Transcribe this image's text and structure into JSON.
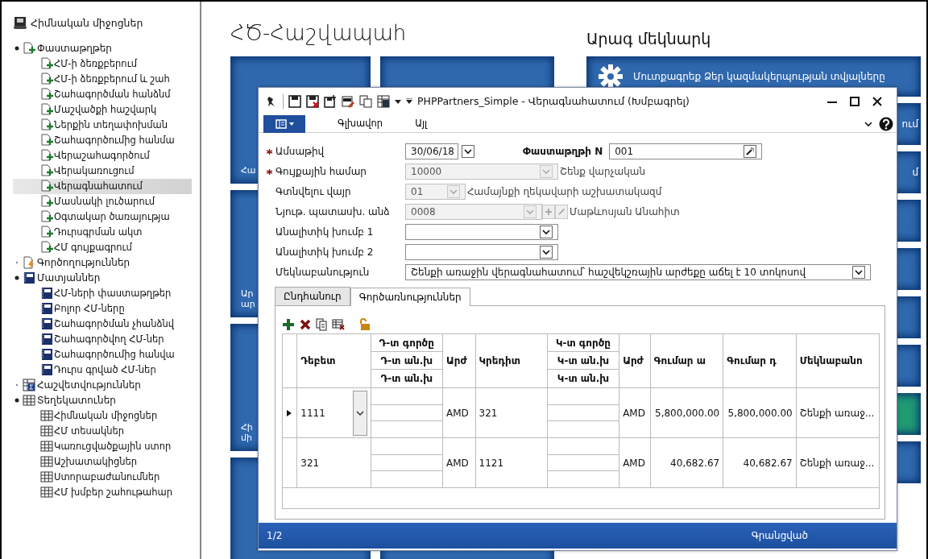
{
  "sidebar": {
    "title": "Հիմնական միջոցներ",
    "groups": [
      {
        "label": "Փաստաթղթեր",
        "kind": "document",
        "expanded": true,
        "children": [
          {
            "label": "ՀՄ-ի ձեռքբերում",
            "selected": false
          },
          {
            "label": "ՀՄ-ի ձեռքբերում և շահ",
            "selected": false
          },
          {
            "label": "Շահագործման հանձնմ",
            "selected": false
          },
          {
            "label": "Մաշվածքի հաշվարկ",
            "selected": false
          },
          {
            "label": "Ներքին տեղափոխման",
            "selected": false
          },
          {
            "label": "Շահագործումից հանմա",
            "selected": false
          },
          {
            "label": "Վերաշահագործում",
            "selected": false
          },
          {
            "label": "Վերակառուցում",
            "selected": false
          },
          {
            "label": "Վերագնահատում",
            "selected": true
          },
          {
            "label": "Մասնակի լուծարում",
            "selected": false
          },
          {
            "label": "Օգտակար ծառայությա",
            "selected": false
          },
          {
            "label": "Դուրսգրման ակտ",
            "selected": false
          },
          {
            "label": "ՀՄ գույքագրում",
            "selected": false
          }
        ]
      },
      {
        "label": "Գործողություններ",
        "kind": "action",
        "expanded": false
      },
      {
        "label": "Մատյաններ",
        "kind": "journal",
        "expanded": true,
        "children": [
          {
            "label": "ՀՄ-ների փաստաթղթեր",
            "selected": false
          },
          {
            "label": "Բոլոր ՀՄ-ները",
            "selected": false
          },
          {
            "label": "Շահագործման չհանձնվ",
            "selected": false
          },
          {
            "label": "Շահագործվող ՀՄ-ներ",
            "selected": false
          },
          {
            "label": "Շահագործումից հանվա",
            "selected": false
          },
          {
            "label": "Դուրս գրված ՀՄ-ներ",
            "selected": false
          }
        ]
      },
      {
        "label": "Հաշվետվություններ",
        "kind": "report",
        "expanded": false
      },
      {
        "label": "Տեղեկատուներ",
        "kind": "table",
        "expanded": true,
        "children": [
          {
            "label": "Հիմնական միջոցներ",
            "selected": false
          },
          {
            "label": "ՀՄ տեսակներ",
            "selected": false
          },
          {
            "label": "Կառուցվածքային ստոր",
            "selected": false
          },
          {
            "label": "Աշխատակիցներ",
            "selected": false
          },
          {
            "label": "Ստորաբաժանումներ",
            "selected": false
          },
          {
            "label": "ՀՄ խմբեր շահութահար",
            "selected": false
          }
        ]
      }
    ]
  },
  "main": {
    "title": "ՀԾ-Հաշվապահ",
    "tiles": [
      {
        "kind": "labelled",
        "lines": [
          "Հա"
        ]
      },
      {
        "kind": "labelled",
        "lines": [
          "Ար",
          "ար"
        ]
      },
      {
        "kind": "labelled",
        "lines": [
          "Հի",
          "մի"
        ]
      },
      {
        "kind": "plain"
      }
    ],
    "quick_start": {
      "title": "Արագ մեկնարկ",
      "tiles": [
        {
          "kind": "settings",
          "label": "Մուտքագրեք Ձեր կազմակերպության տվյալները",
          "color": "#2f68ad"
        },
        {
          "kind": "plain",
          "label": "ում",
          "color": "#2f68ad"
        },
        {
          "kind": "plain",
          "label": "մ",
          "color": "#2f68ad"
        },
        {
          "kind": "plain",
          "color": "#2f68ad"
        },
        {
          "kind": "plain",
          "color": "#2f68ad"
        },
        {
          "kind": "plain",
          "color": "#2f68ad"
        },
        {
          "kind": "plain",
          "color": "#2f68ad"
        },
        {
          "kind": "plain",
          "color": "#1f9a73"
        },
        {
          "kind": "plain",
          "color": "#2f68ad"
        }
      ]
    }
  },
  "dialog": {
    "title": "PHPPartners_Simple - Վերագնահատում (Խմբագրել)",
    "menu": [
      {
        "label": "Գլխավոր"
      },
      {
        "label": "Այլ"
      }
    ],
    "fields": [
      {
        "kind": "date",
        "label": "Ամսաթիվ",
        "required": true,
        "value": "30/06/18",
        "disabled": false
      },
      {
        "kind": "combo",
        "label": "Գույքային համար",
        "required": true,
        "value": "10000",
        "disabled": true,
        "note": "Շենք վարչական"
      },
      {
        "kind": "short-combo",
        "label": "Գտնվելու վայր",
        "required": false,
        "value": "01",
        "disabled": true,
        "note": "Համայնքի ղեկավարի աշխատակազմ"
      },
      {
        "kind": "combo-edit",
        "label": "Նյութ. պատասխ. անձ",
        "required": false,
        "value": "0008",
        "disabled": true,
        "note": "Մաթևոսյան Անահիտ"
      },
      {
        "kind": "select",
        "label": "Անալիտիկ խումբ 1",
        "required": false,
        "disabled": false
      },
      {
        "kind": "select",
        "label": "Անալիտիկ խումբ 2",
        "required": false,
        "disabled": false
      },
      {
        "kind": "wide-select",
        "label": "Մեկնաբանություն",
        "required": false,
        "value": "Շենքի առաջին վերագնահատում՝ հաշվեկշռային արժեքը աճել է 10 տոկոսով",
        "disabled": false
      }
    ],
    "document_number": {
      "label": "Փաստաթղթի N",
      "value": "001"
    },
    "tabs": [
      {
        "label": "Ընդհանուր",
        "selected": false
      },
      {
        "label": "Գործառնություններ",
        "selected": true
      }
    ],
    "grid": {
      "columns": [
        {
          "kind": "single",
          "label": "Դեբետ"
        },
        {
          "kind": "stack",
          "labels": [
            "Դ-տ գործը",
            "Դ-տ ան.խ",
            "Դ-տ ան.խ"
          ]
        },
        {
          "kind": "single",
          "label": "Արժ"
        },
        {
          "kind": "single",
          "label": "Կրեդիտ"
        },
        {
          "kind": "stack",
          "labels": [
            "Կ-տ գործը",
            "Կ-տ ան.խ",
            "Կ-տ ան.խ"
          ]
        },
        {
          "kind": "single",
          "label": "Արժ"
        },
        {
          "kind": "single",
          "label": "Գումար ա"
        },
        {
          "kind": "single",
          "label": "Գումար դ"
        },
        {
          "kind": "single",
          "label": "Մեկնաբանո"
        }
      ],
      "rows": [
        {
          "current": true,
          "debit": "1111",
          "currency_1": "AMD",
          "credit": "321",
          "currency_2": "AMD",
          "amount_1": "5,800,000.00",
          "amount_2": "5,800,000.00",
          "comment": "Շենքի առաջ..."
        },
        {
          "current": false,
          "debit": "321",
          "currency_1": "AMD",
          "credit": "1121",
          "currency_2": "AMD",
          "amount_1": "40,682.67",
          "amount_2": "40,682.67",
          "comment": "Շենքի առաջ..."
        }
      ]
    },
    "status": {
      "page": "1/2",
      "state": "Գրանցված"
    }
  }
}
